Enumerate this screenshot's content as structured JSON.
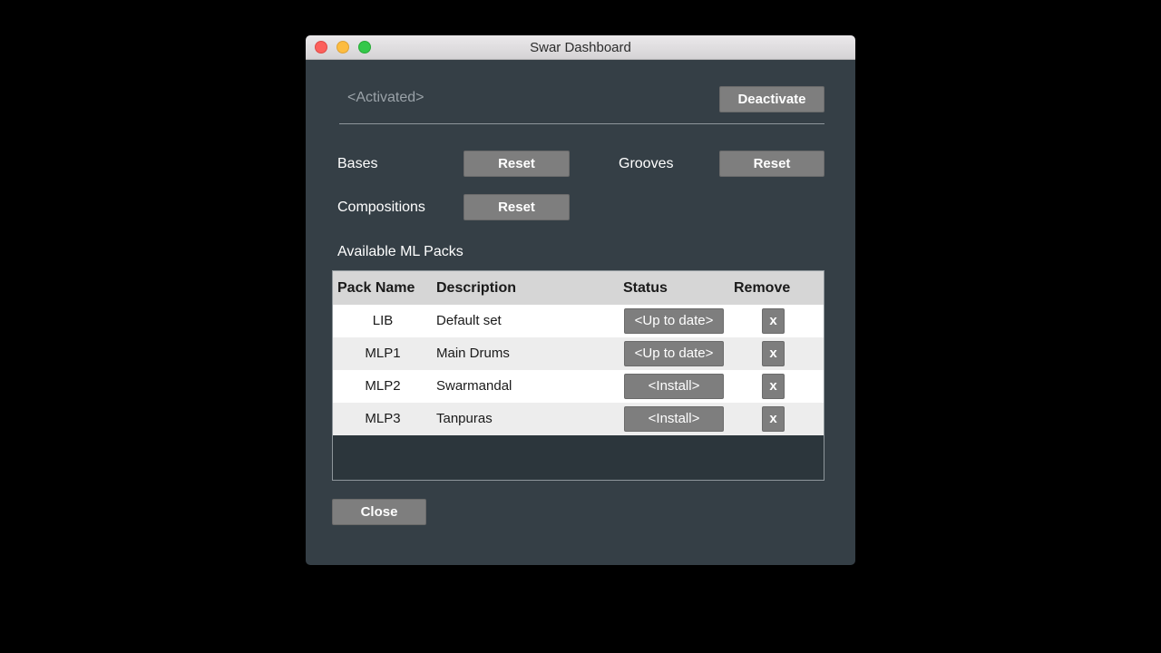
{
  "window": {
    "title": "Swar Dashboard"
  },
  "activation": {
    "status": "<Activated>",
    "deactivate_label": "Deactivate"
  },
  "resets": {
    "bases_label": "Bases",
    "grooves_label": "Grooves",
    "compositions_label": "Compositions",
    "reset_label": "Reset"
  },
  "packs": {
    "heading": "Available ML Packs",
    "columns": [
      "Pack Name",
      "Description",
      "Status",
      "Remove"
    ],
    "rows": [
      {
        "name": "LIB",
        "description": "Default set",
        "status": "<Up to date>",
        "remove": "x"
      },
      {
        "name": "MLP1",
        "description": "Main Drums",
        "status": "<Up to date>",
        "remove": "x"
      },
      {
        "name": "MLP2",
        "description": "Swarmandal",
        "status": "<Install>",
        "remove": "x"
      },
      {
        "name": "MLP3",
        "description": "Tanpuras",
        "status": "<Install>",
        "remove": "x"
      }
    ]
  },
  "footer": {
    "close_label": "Close"
  },
  "colors": {
    "window_bg": "#353f46",
    "button_bg": "#7e7e7e",
    "header_bg": "#d6d6d6"
  }
}
